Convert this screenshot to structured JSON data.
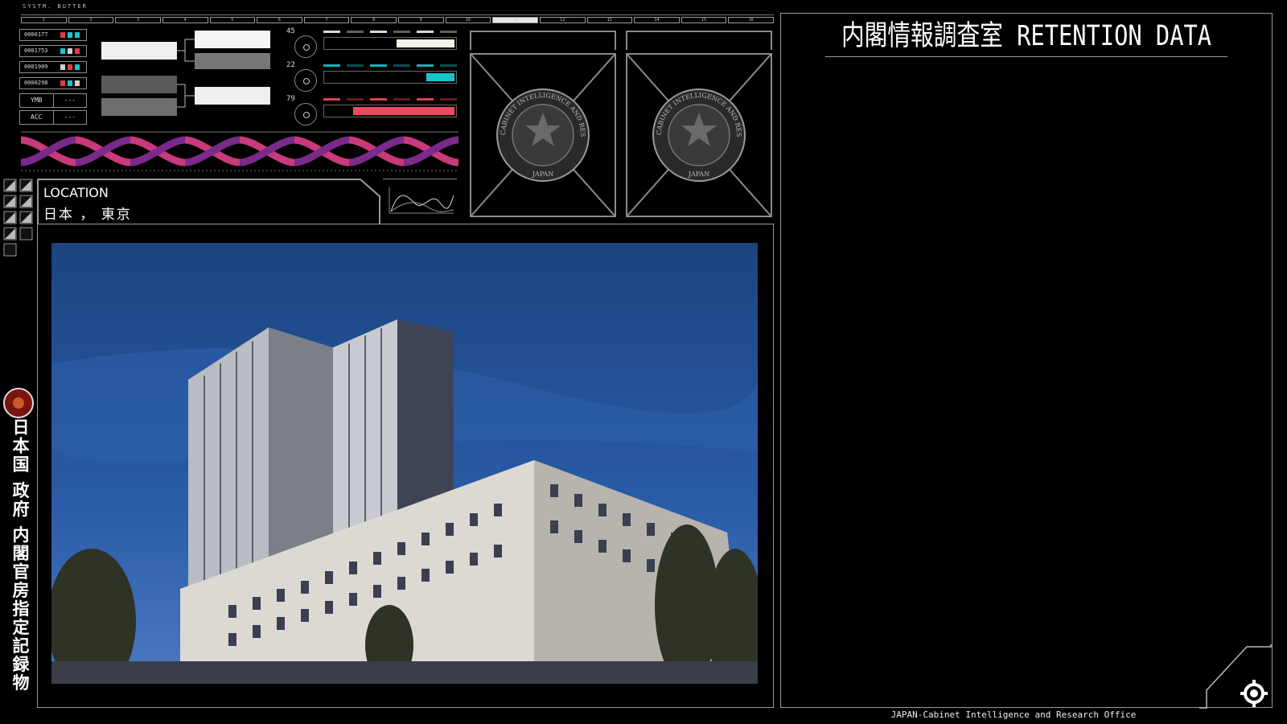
{
  "top_strip": {
    "header": "SYSTM. BUTTER",
    "cells": [
      "1",
      "2",
      "3",
      "4",
      "5",
      "6",
      "7",
      "8",
      "9",
      "10",
      "11",
      "12",
      "13",
      "14",
      "15",
      "16"
    ],
    "active_index": 10
  },
  "id_list": [
    {
      "id": "0000177",
      "swatches": [
        "#e23a4a",
        "#19c4c8",
        "#19c4c8"
      ]
    },
    {
      "id": "0001753",
      "swatches": [
        "#19c4c8",
        "#cfcfcf",
        "#e23a4a"
      ]
    },
    {
      "id": "0001909",
      "swatches": [
        "#cfcfcf",
        "#e23a4a",
        "#19c4c8"
      ]
    },
    {
      "id": "0000298",
      "swatches": [
        "#e23a4a",
        "#19c4c8",
        "#cfcfcf"
      ]
    }
  ],
  "kv": [
    {
      "key": "YMB",
      "value": "---"
    },
    {
      "key": "ACC",
      "value": "---"
    }
  ],
  "gauges": [
    {
      "value": "45",
      "level": 0.45,
      "color": "#f5f0e6"
    },
    {
      "value": "22",
      "level": 0.22,
      "color": "#19c4c8"
    },
    {
      "value": "79",
      "level": 0.79,
      "color": "#f0485c"
    }
  ],
  "seal": {
    "ring_text": "CABINET INTELLIGENCE AND RESEARCH OFFICE",
    "bottom_text": "JAPAN"
  },
  "location": {
    "label": "LOCATION",
    "value": "日本 ， 東京"
  },
  "side_label": "日本国 政府 内閣官房指定記録物",
  "retention": {
    "title": "内閣情報調査室 RETENTION DATA"
  },
  "footer": "JAPAN-Cabinet Intelligence and Research Office",
  "colors": {
    "cyan": "#19c4c8",
    "red": "#f0485c",
    "frame": "#8a8a8a",
    "sky": "#1d4b8f"
  }
}
